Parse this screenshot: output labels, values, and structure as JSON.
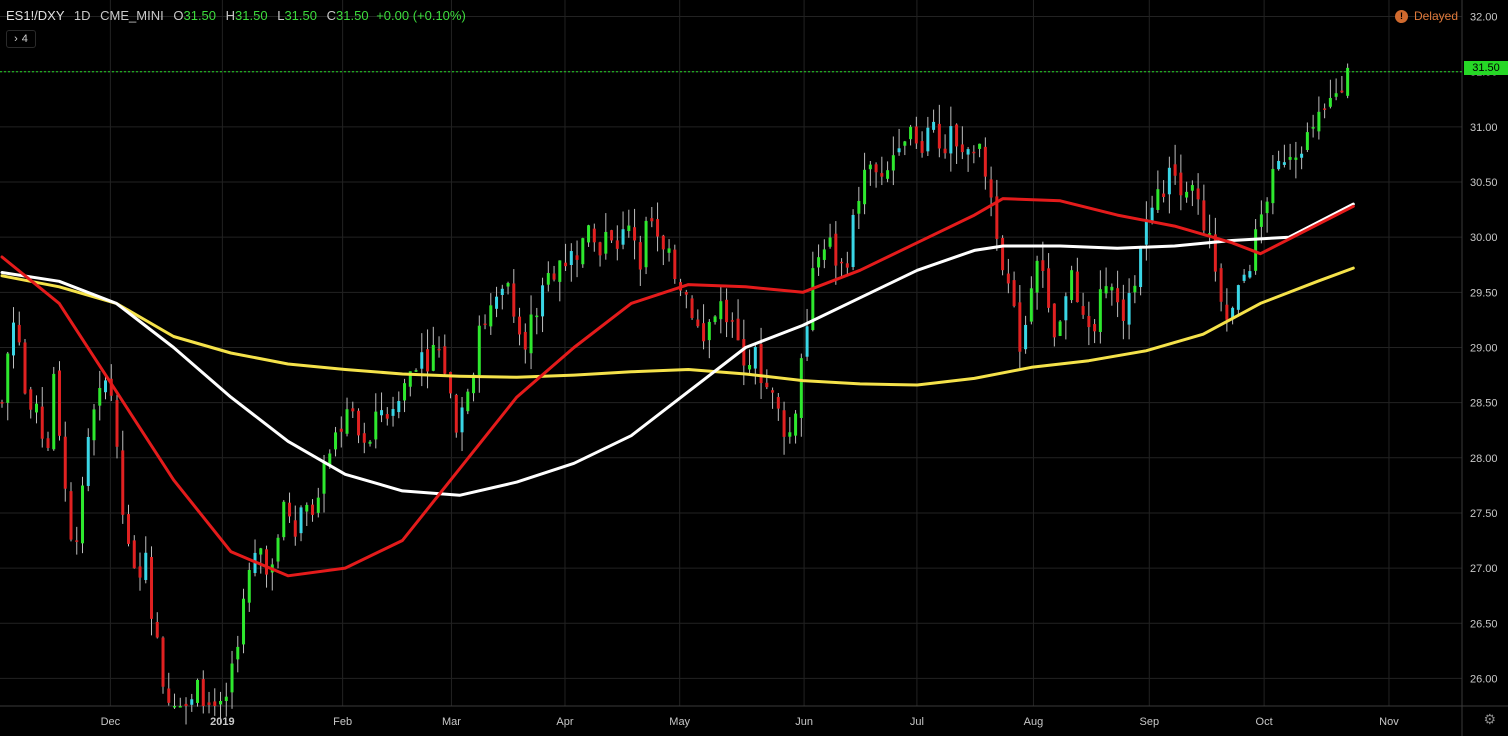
{
  "header": {
    "symbol": "ES1!/DXY",
    "interval": "1D",
    "source": "CME_MINI",
    "open_label": "O",
    "open": "31.50",
    "high_label": "H",
    "high": "31.50",
    "low_label": "L",
    "low": "31.50",
    "close_label": "C",
    "close": "31.50",
    "change": "+0.00 (+0.10%)"
  },
  "indicators_toggle": {
    "chevron": "›",
    "count": "4"
  },
  "status": {
    "label": "Delayed",
    "icon": "!"
  },
  "last_price_tag": "31.50",
  "settings_icon": "⚙",
  "colors": {
    "background": "#000000",
    "grid": "#222222",
    "up": "#2ee82e",
    "up_alt": "#3ad6e6",
    "down": "#e02121",
    "ma_red": "#e41b1b",
    "ma_white": "#ffffff",
    "ma_yellow": "#f5e24a",
    "axis_text": "#c8c8c8"
  },
  "chart_data": {
    "type": "candlestick",
    "title": "",
    "ylim": [
      25.75,
      32.15
    ],
    "y_ticks": [
      "26.00",
      "26.50",
      "27.00",
      "27.50",
      "28.00",
      "28.50",
      "29.00",
      "29.50",
      "30.00",
      "30.50",
      "31.00",
      "31.50",
      "32.00"
    ],
    "x_ticks": [
      {
        "label": "Dec",
        "t": 0.0758
      },
      {
        "label": "2019",
        "t": 0.1541
      },
      {
        "label": "Feb",
        "t": 0.2382
      },
      {
        "label": "Mar",
        "t": 0.3143
      },
      {
        "label": "Apr",
        "t": 0.3937
      },
      {
        "label": "May",
        "t": 0.4739
      },
      {
        "label": "Jun",
        "t": 0.5609
      },
      {
        "label": "Jul",
        "t": 0.6398
      },
      {
        "label": "Aug",
        "t": 0.7213
      },
      {
        "label": "Sep",
        "t": 0.8023
      },
      {
        "label": "Oct",
        "t": 0.8826
      },
      {
        "label": "Nov",
        "t": 0.9699
      }
    ],
    "close_path": [
      [
        0.0,
        28.5
      ],
      [
        0.007,
        29.3
      ],
      [
        0.013,
        29.0
      ],
      [
        0.018,
        28.3
      ],
      [
        0.026,
        28.4
      ],
      [
        0.031,
        28.0
      ],
      [
        0.037,
        28.8
      ],
      [
        0.043,
        27.8
      ],
      [
        0.05,
        27.2
      ],
      [
        0.056,
        27.6
      ],
      [
        0.062,
        28.3
      ],
      [
        0.068,
        28.5
      ],
      [
        0.075,
        28.8
      ],
      [
        0.081,
        27.9
      ],
      [
        0.087,
        27.2
      ],
      [
        0.093,
        26.9
      ],
      [
        0.1,
        27.1
      ],
      [
        0.106,
        26.5
      ],
      [
        0.112,
        26.0
      ],
      [
        0.118,
        25.8
      ],
      [
        0.124,
        25.6
      ],
      [
        0.131,
        25.7
      ],
      [
        0.137,
        25.9
      ],
      [
        0.143,
        25.8
      ],
      [
        0.15,
        25.6
      ],
      [
        0.156,
        25.8
      ],
      [
        0.162,
        26.2
      ],
      [
        0.168,
        26.6
      ],
      [
        0.174,
        27.0
      ],
      [
        0.18,
        27.2
      ],
      [
        0.187,
        27.0
      ],
      [
        0.193,
        27.3
      ],
      [
        0.199,
        27.6
      ],
      [
        0.205,
        27.4
      ],
      [
        0.211,
        27.6
      ],
      [
        0.218,
        27.6
      ],
      [
        0.224,
        27.8
      ],
      [
        0.23,
        28.1
      ],
      [
        0.236,
        28.3
      ],
      [
        0.242,
        28.4
      ],
      [
        0.249,
        28.2
      ],
      [
        0.255,
        28.0
      ],
      [
        0.261,
        28.3
      ],
      [
        0.267,
        28.5
      ],
      [
        0.273,
        28.3
      ],
      [
        0.279,
        28.6
      ],
      [
        0.286,
        28.8
      ],
      [
        0.292,
        29.0
      ],
      [
        0.298,
        28.9
      ],
      [
        0.304,
        29.0
      ],
      [
        0.31,
        28.8
      ],
      [
        0.317,
        28.3
      ],
      [
        0.323,
        28.5
      ],
      [
        0.329,
        28.8
      ],
      [
        0.335,
        29.2
      ],
      [
        0.341,
        29.3
      ],
      [
        0.348,
        29.4
      ],
      [
        0.354,
        29.6
      ],
      [
        0.36,
        29.3
      ],
      [
        0.366,
        29.1
      ],
      [
        0.372,
        29.3
      ],
      [
        0.379,
        29.5
      ],
      [
        0.385,
        29.7
      ],
      [
        0.391,
        29.8
      ],
      [
        0.397,
        29.8
      ],
      [
        0.403,
        29.9
      ],
      [
        0.409,
        30.0
      ],
      [
        0.416,
        29.9
      ],
      [
        0.422,
        30.0
      ],
      [
        0.428,
        29.9
      ],
      [
        0.434,
        30.0
      ],
      [
        0.441,
        30.1
      ],
      [
        0.447,
        29.8
      ],
      [
        0.453,
        30.2
      ],
      [
        0.459,
        29.9
      ],
      [
        0.465,
        29.8
      ],
      [
        0.471,
        29.7
      ],
      [
        0.478,
        29.5
      ],
      [
        0.484,
        29.3
      ],
      [
        0.49,
        29.0
      ],
      [
        0.496,
        29.3
      ],
      [
        0.502,
        29.4
      ],
      [
        0.509,
        29.2
      ],
      [
        0.515,
        29.0
      ],
      [
        0.521,
        28.9
      ],
      [
        0.527,
        28.9
      ],
      [
        0.533,
        28.7
      ],
      [
        0.54,
        28.5
      ],
      [
        0.546,
        28.3
      ],
      [
        0.552,
        28.2
      ],
      [
        0.558,
        28.8
      ],
      [
        0.564,
        29.3
      ],
      [
        0.57,
        29.9
      ],
      [
        0.577,
        30.0
      ],
      [
        0.583,
        29.8
      ],
      [
        0.589,
        29.7
      ],
      [
        0.595,
        30.1
      ],
      [
        0.601,
        30.5
      ],
      [
        0.608,
        30.7
      ],
      [
        0.614,
        30.4
      ],
      [
        0.62,
        30.6
      ],
      [
        0.626,
        30.9
      ],
      [
        0.632,
        31.0
      ],
      [
        0.638,
        30.8
      ],
      [
        0.645,
        30.9
      ],
      [
        0.651,
        31.1
      ],
      [
        0.657,
        30.8
      ],
      [
        0.663,
        30.9
      ],
      [
        0.67,
        30.7
      ],
      [
        0.676,
        30.8
      ],
      [
        0.682,
        30.8
      ],
      [
        0.688,
        30.6
      ],
      [
        0.694,
        30.2
      ],
      [
        0.7,
        29.8
      ],
      [
        0.707,
        29.3
      ],
      [
        0.713,
        29.0
      ],
      [
        0.719,
        29.5
      ],
      [
        0.725,
        29.9
      ],
      [
        0.731,
        29.3
      ],
      [
        0.738,
        29.0
      ],
      [
        0.744,
        29.4
      ],
      [
        0.75,
        29.7
      ],
      [
        0.756,
        29.2
      ],
      [
        0.762,
        29.0
      ],
      [
        0.768,
        29.4
      ],
      [
        0.774,
        29.8
      ],
      [
        0.781,
        29.3
      ],
      [
        0.787,
        29.3
      ],
      [
        0.793,
        29.7
      ],
      [
        0.799,
        30.1
      ],
      [
        0.805,
        30.3
      ],
      [
        0.811,
        30.4
      ],
      [
        0.818,
        30.6
      ],
      [
        0.824,
        30.5
      ],
      [
        0.83,
        30.5
      ],
      [
        0.836,
        30.3
      ],
      [
        0.842,
        30.1
      ],
      [
        0.848,
        29.7
      ],
      [
        0.855,
        29.4
      ],
      [
        0.861,
        29.3
      ],
      [
        0.867,
        29.6
      ],
      [
        0.873,
        29.8
      ],
      [
        0.879,
        30.1
      ],
      [
        0.885,
        30.4
      ],
      [
        0.892,
        30.6
      ],
      [
        0.898,
        30.8
      ],
      [
        0.904,
        30.8
      ],
      [
        0.91,
        30.9
      ],
      [
        0.916,
        30.9
      ],
      [
        0.922,
        31.1
      ],
      [
        0.928,
        31.2
      ],
      [
        0.935,
        31.4
      ],
      [
        0.941,
        31.5
      ]
    ],
    "series": [
      {
        "name": "",
        "color": "#f5e24a",
        "points": [
          [
            0.0,
            29.65
          ],
          [
            0.04,
            29.55
          ],
          [
            0.08,
            29.4
          ],
          [
            0.12,
            29.1
          ],
          [
            0.16,
            28.95
          ],
          [
            0.2,
            28.85
          ],
          [
            0.24,
            28.8
          ],
          [
            0.28,
            28.76
          ],
          [
            0.32,
            28.74
          ],
          [
            0.36,
            28.73
          ],
          [
            0.4,
            28.75
          ],
          [
            0.44,
            28.78
          ],
          [
            0.48,
            28.8
          ],
          [
            0.52,
            28.76
          ],
          [
            0.56,
            28.7
          ],
          [
            0.6,
            28.67
          ],
          [
            0.64,
            28.66
          ],
          [
            0.68,
            28.72
          ],
          [
            0.72,
            28.82
          ],
          [
            0.76,
            28.88
          ],
          [
            0.8,
            28.97
          ],
          [
            0.84,
            29.12
          ],
          [
            0.88,
            29.4
          ],
          [
            0.92,
            29.6
          ],
          [
            0.945,
            29.72
          ]
        ]
      },
      {
        "name": "",
        "color": "#ffffff",
        "points": [
          [
            0.0,
            29.68
          ],
          [
            0.04,
            29.6
          ],
          [
            0.08,
            29.4
          ],
          [
            0.12,
            29.0
          ],
          [
            0.16,
            28.55
          ],
          [
            0.2,
            28.15
          ],
          [
            0.24,
            27.85
          ],
          [
            0.28,
            27.7
          ],
          [
            0.32,
            27.66
          ],
          [
            0.36,
            27.78
          ],
          [
            0.4,
            27.95
          ],
          [
            0.44,
            28.2
          ],
          [
            0.48,
            28.6
          ],
          [
            0.52,
            29.0
          ],
          [
            0.56,
            29.2
          ],
          [
            0.6,
            29.45
          ],
          [
            0.64,
            29.7
          ],
          [
            0.68,
            29.88
          ],
          [
            0.7,
            29.92
          ],
          [
            0.74,
            29.92
          ],
          [
            0.78,
            29.9
          ],
          [
            0.82,
            29.92
          ],
          [
            0.86,
            29.97
          ],
          [
            0.9,
            30.0
          ],
          [
            0.945,
            30.3
          ]
        ]
      },
      {
        "name": "",
        "color": "#e41b1b",
        "points": [
          [
            0.0,
            29.82
          ],
          [
            0.04,
            29.4
          ],
          [
            0.08,
            28.6
          ],
          [
            0.12,
            27.8
          ],
          [
            0.16,
            27.15
          ],
          [
            0.2,
            26.93
          ],
          [
            0.24,
            27.0
          ],
          [
            0.28,
            27.25
          ],
          [
            0.32,
            27.9
          ],
          [
            0.36,
            28.55
          ],
          [
            0.4,
            29.0
          ],
          [
            0.44,
            29.4
          ],
          [
            0.48,
            29.57
          ],
          [
            0.52,
            29.55
          ],
          [
            0.56,
            29.5
          ],
          [
            0.6,
            29.7
          ],
          [
            0.64,
            29.95
          ],
          [
            0.68,
            30.2
          ],
          [
            0.7,
            30.35
          ],
          [
            0.74,
            30.33
          ],
          [
            0.78,
            30.2
          ],
          [
            0.82,
            30.1
          ],
          [
            0.86,
            29.95
          ],
          [
            0.88,
            29.85
          ],
          [
            0.945,
            30.28
          ]
        ]
      }
    ],
    "last_price": 31.5,
    "grid": true
  }
}
